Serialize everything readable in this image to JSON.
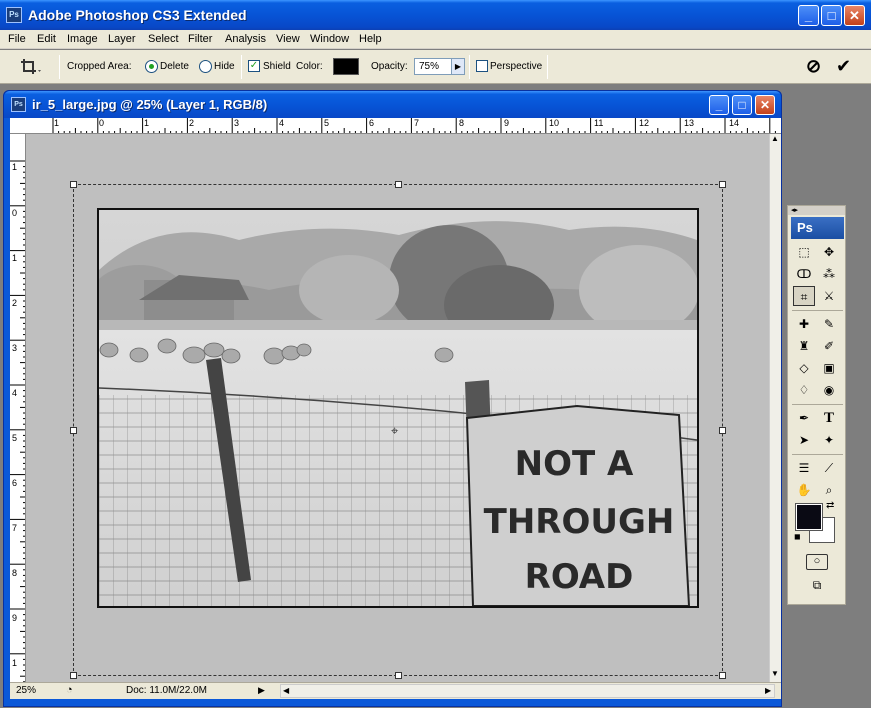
{
  "window": {
    "app_icon": "Ps",
    "title": "Adobe Photoshop CS3 Extended",
    "minimize": "_",
    "maximize": "□",
    "close": "✕"
  },
  "menu": [
    "File",
    "Edit",
    "Image",
    "Layer",
    "Select",
    "Filter",
    "Analysis",
    "View",
    "Window",
    "Help"
  ],
  "options": {
    "tool_icon": "crop-icon",
    "cropped_area_label": "Cropped Area:",
    "delete_label": "Delete",
    "delete_selected": true,
    "hide_label": "Hide",
    "shield_label": "Shield",
    "shield_checked": true,
    "color_label": "Color:",
    "shield_color": "#000000",
    "opacity_label": "Opacity:",
    "opacity_value": "75%",
    "perspective_label": "Perspective",
    "perspective_checked": false,
    "cancel_icon": "⊘",
    "commit_icon": "✔"
  },
  "document": {
    "icon": "Ps",
    "title": "ir_5_large.jpg @ 25% (Layer 1, RGB/8)",
    "h_ruler": [
      "1",
      "0",
      "1",
      "2",
      "3",
      "4",
      "5",
      "6",
      "7",
      "8",
      "9",
      "10",
      "11",
      "12",
      "13",
      "14"
    ],
    "v_ruler": [
      "1",
      "0",
      "1",
      "2",
      "3",
      "4",
      "5",
      "6",
      "7",
      "8",
      "9",
      "1"
    ],
    "sign_text": [
      "NOT A",
      "THROUGH",
      "ROAD"
    ],
    "zoom": "25%",
    "doc_info": "Doc: 11.0M/22.0M",
    "status_arrow": "▶"
  },
  "tools": {
    "header": "Ps",
    "grip": "◂▸"
  },
  "colors": {
    "foreground": "#0a0a14",
    "background": "#ffffff"
  }
}
